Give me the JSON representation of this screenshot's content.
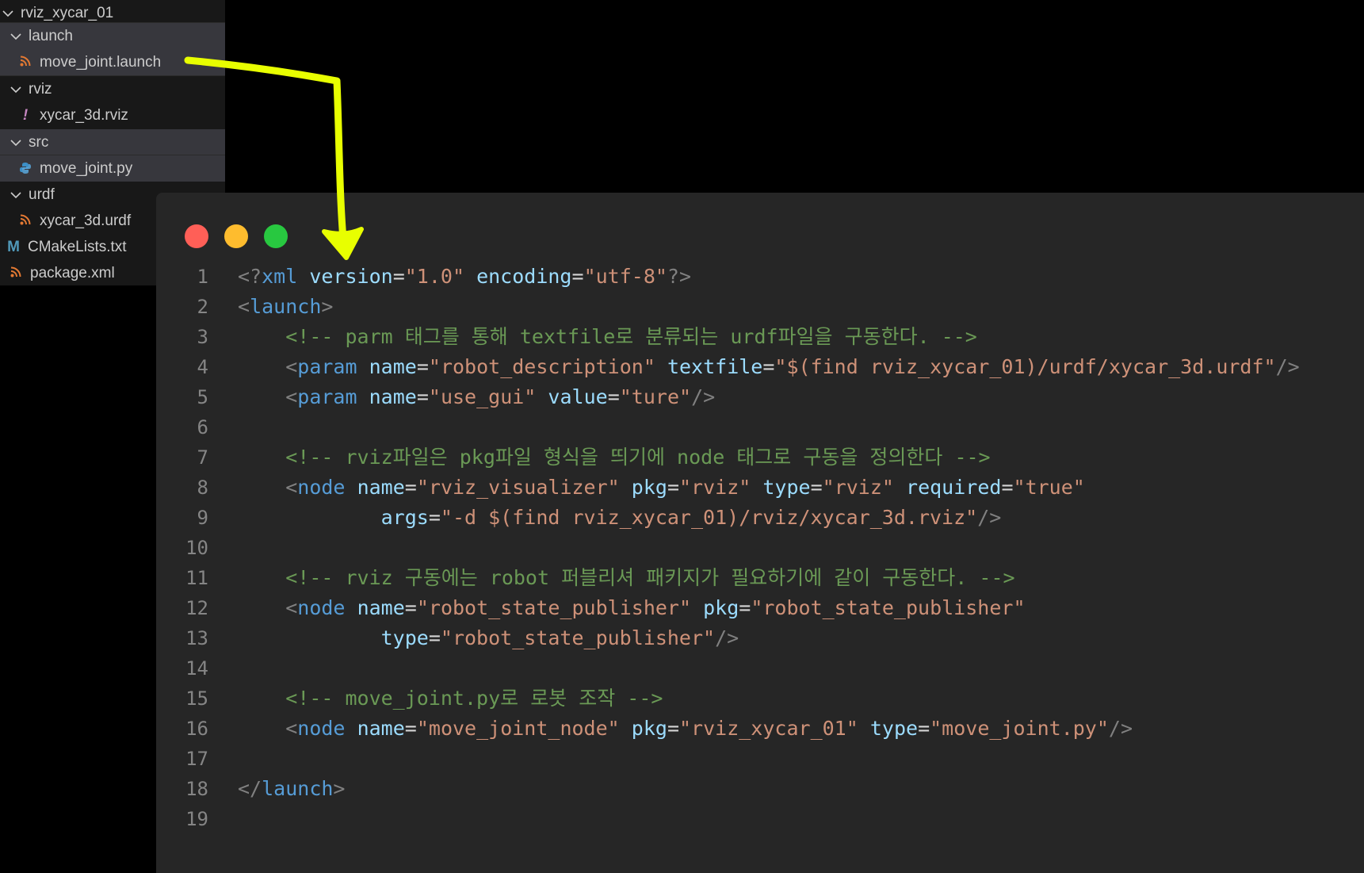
{
  "explorer": {
    "items": [
      {
        "label": "rviz_xycar_01",
        "kind": "folder"
      },
      {
        "label": "launch",
        "kind": "folder"
      },
      {
        "label": "move_joint.launch",
        "kind": "file",
        "icon": "rss-icon"
      },
      {
        "label": "rviz",
        "kind": "folder"
      },
      {
        "label": "xycar_3d.rviz",
        "kind": "file",
        "icon": "exclamation-icon"
      },
      {
        "label": "src",
        "kind": "folder"
      },
      {
        "label": "move_joint.py",
        "kind": "file",
        "icon": "python-icon"
      },
      {
        "label": "urdf",
        "kind": "folder"
      },
      {
        "label": "xycar_3d.urdf",
        "kind": "file",
        "icon": "rss-icon"
      },
      {
        "label": "CMakeLists.txt",
        "kind": "file",
        "icon": "m-icon",
        "icon_text": "M"
      },
      {
        "label": "package.xml",
        "kind": "file",
        "icon": "rss-icon"
      }
    ]
  },
  "colors": {
    "traffic_red": "#ff5f57",
    "traffic_yellow": "#febc2e",
    "traffic_green": "#28c840",
    "arrow": "#e8ff00",
    "rss_orange": "#e37933",
    "exclaim_purple": "#c586c0",
    "python_blue": "#3c8fc7",
    "cmake_blue": "#519aba"
  },
  "code": {
    "lines": [
      {
        "n": "1",
        "tokens": [
          [
            "punc",
            "<?"
          ],
          [
            "tag",
            "xml"
          ],
          [
            "plain",
            " "
          ],
          [
            "attr",
            "version"
          ],
          [
            "eq",
            "="
          ],
          [
            "str",
            "\"1.0\""
          ],
          [
            "plain",
            " "
          ],
          [
            "attr",
            "encoding"
          ],
          [
            "eq",
            "="
          ],
          [
            "str",
            "\"utf-8\""
          ],
          [
            "punc",
            "?>"
          ]
        ]
      },
      {
        "n": "2",
        "tokens": [
          [
            "punc",
            "<"
          ],
          [
            "tag",
            "launch"
          ],
          [
            "punc",
            ">"
          ]
        ]
      },
      {
        "n": "3",
        "tokens": [
          [
            "plain",
            "    "
          ],
          [
            "com",
            "<!-- parm 태그를 통해 textfile로 분류되는 urdf파일을 구동한다. -->"
          ]
        ]
      },
      {
        "n": "4",
        "tokens": [
          [
            "plain",
            "    "
          ],
          [
            "punc",
            "<"
          ],
          [
            "tag",
            "param"
          ],
          [
            "plain",
            " "
          ],
          [
            "attr",
            "name"
          ],
          [
            "eq",
            "="
          ],
          [
            "str",
            "\"robot_description\""
          ],
          [
            "plain",
            " "
          ],
          [
            "attr",
            "textfile"
          ],
          [
            "eq",
            "="
          ],
          [
            "str",
            "\"$(find rviz_xycar_01)/urdf/xycar_3d.urdf\""
          ],
          [
            "punc",
            "/>"
          ]
        ]
      },
      {
        "n": "5",
        "tokens": [
          [
            "plain",
            "    "
          ],
          [
            "punc",
            "<"
          ],
          [
            "tag",
            "param"
          ],
          [
            "plain",
            " "
          ],
          [
            "attr",
            "name"
          ],
          [
            "eq",
            "="
          ],
          [
            "str",
            "\"use_gui\""
          ],
          [
            "plain",
            " "
          ],
          [
            "attr",
            "value"
          ],
          [
            "eq",
            "="
          ],
          [
            "str",
            "\"ture\""
          ],
          [
            "punc",
            "/>"
          ]
        ]
      },
      {
        "n": "6",
        "tokens": []
      },
      {
        "n": "7",
        "tokens": [
          [
            "plain",
            "    "
          ],
          [
            "com",
            "<!-- rviz파일은 pkg파일 형식을 띄기에 node 태그로 구동을 정의한다 -->"
          ]
        ]
      },
      {
        "n": "8",
        "tokens": [
          [
            "plain",
            "    "
          ],
          [
            "punc",
            "<"
          ],
          [
            "tag",
            "node"
          ],
          [
            "plain",
            " "
          ],
          [
            "attr",
            "name"
          ],
          [
            "eq",
            "="
          ],
          [
            "str",
            "\"rviz_visualizer\""
          ],
          [
            "plain",
            " "
          ],
          [
            "attr",
            "pkg"
          ],
          [
            "eq",
            "="
          ],
          [
            "str",
            "\"rviz\""
          ],
          [
            "plain",
            " "
          ],
          [
            "attr",
            "type"
          ],
          [
            "eq",
            "="
          ],
          [
            "str",
            "\"rviz\""
          ],
          [
            "plain",
            " "
          ],
          [
            "attr",
            "required"
          ],
          [
            "eq",
            "="
          ],
          [
            "str",
            "\"true\""
          ]
        ]
      },
      {
        "n": "9",
        "tokens": [
          [
            "plain",
            "            "
          ],
          [
            "attr",
            "args"
          ],
          [
            "eq",
            "="
          ],
          [
            "str",
            "\"-d $(find rviz_xycar_01)/rviz/xycar_3d.rviz\""
          ],
          [
            "punc",
            "/>"
          ]
        ]
      },
      {
        "n": "10",
        "tokens": []
      },
      {
        "n": "11",
        "tokens": [
          [
            "plain",
            "    "
          ],
          [
            "com",
            "<!-- rviz 구동에는 robot 퍼블리셔 패키지가 필요하기에 같이 구동한다. -->"
          ]
        ]
      },
      {
        "n": "12",
        "tokens": [
          [
            "plain",
            "    "
          ],
          [
            "punc",
            "<"
          ],
          [
            "tag",
            "node"
          ],
          [
            "plain",
            " "
          ],
          [
            "attr",
            "name"
          ],
          [
            "eq",
            "="
          ],
          [
            "str",
            "\"robot_state_publisher\""
          ],
          [
            "plain",
            " "
          ],
          [
            "attr",
            "pkg"
          ],
          [
            "eq",
            "="
          ],
          [
            "str",
            "\"robot_state_publisher\""
          ]
        ]
      },
      {
        "n": "13",
        "tokens": [
          [
            "plain",
            "            "
          ],
          [
            "attr",
            "type"
          ],
          [
            "eq",
            "="
          ],
          [
            "str",
            "\"robot_state_publisher\""
          ],
          [
            "punc",
            "/>"
          ]
        ]
      },
      {
        "n": "14",
        "tokens": []
      },
      {
        "n": "15",
        "tokens": [
          [
            "plain",
            "    "
          ],
          [
            "com",
            "<!-- move_joint.py로 로봇 조작 -->"
          ]
        ]
      },
      {
        "n": "16",
        "tokens": [
          [
            "plain",
            "    "
          ],
          [
            "punc",
            "<"
          ],
          [
            "tag",
            "node"
          ],
          [
            "plain",
            " "
          ],
          [
            "attr",
            "name"
          ],
          [
            "eq",
            "="
          ],
          [
            "str",
            "\"move_joint_node\""
          ],
          [
            "plain",
            " "
          ],
          [
            "attr",
            "pkg"
          ],
          [
            "eq",
            "="
          ],
          [
            "str",
            "\"rviz_xycar_01\""
          ],
          [
            "plain",
            " "
          ],
          [
            "attr",
            "type"
          ],
          [
            "eq",
            "="
          ],
          [
            "str",
            "\"move_joint.py\""
          ],
          [
            "punc",
            "/>"
          ]
        ]
      },
      {
        "n": "17",
        "tokens": []
      },
      {
        "n": "18",
        "tokens": [
          [
            "punc",
            "</"
          ],
          [
            "tag",
            "launch"
          ],
          [
            "punc",
            ">"
          ]
        ]
      },
      {
        "n": "19",
        "tokens": []
      }
    ]
  }
}
